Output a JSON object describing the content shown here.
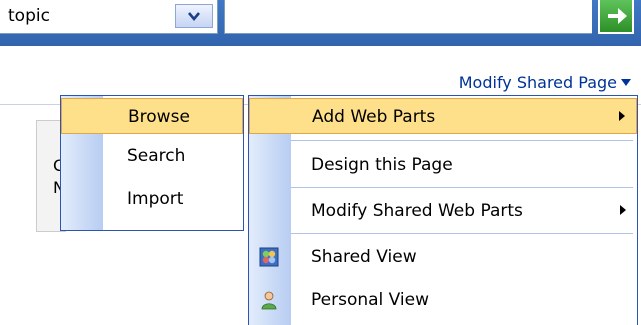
{
  "search": {
    "scope_value": "topic",
    "dropdown_icon": "chevron-down-icon",
    "go_icon": "arrow-right-icon"
  },
  "page_menu": {
    "label": "Modify Shared Page"
  },
  "background_zone": {
    "line1": "C",
    "line2": "N"
  },
  "left_menu": {
    "items": [
      {
        "label": "Browse",
        "highlighted": true
      },
      {
        "label": "Search",
        "highlighted": false
      },
      {
        "label": "Import",
        "highlighted": false
      }
    ]
  },
  "right_menu": {
    "items": [
      {
        "label": "Add Web Parts",
        "highlighted": true,
        "submenu": true
      },
      {
        "label": "Design this Page",
        "highlighted": false,
        "submenu": false
      },
      {
        "label": "Modify Shared Web Parts",
        "highlighted": false,
        "submenu": true
      },
      {
        "label": "Shared View",
        "highlighted": false,
        "submenu": false,
        "icon": "shared-view-icon"
      },
      {
        "label": "Personal View",
        "highlighted": false,
        "submenu": false,
        "icon": "personal-view-icon"
      }
    ]
  },
  "colors": {
    "top_bar": "#3f78c5",
    "link": "#003399",
    "menu_border": "#2e54b3",
    "highlight": "#ffe08a",
    "highlight_border": "#e1a64a",
    "gutter": "#b7cdf2"
  }
}
